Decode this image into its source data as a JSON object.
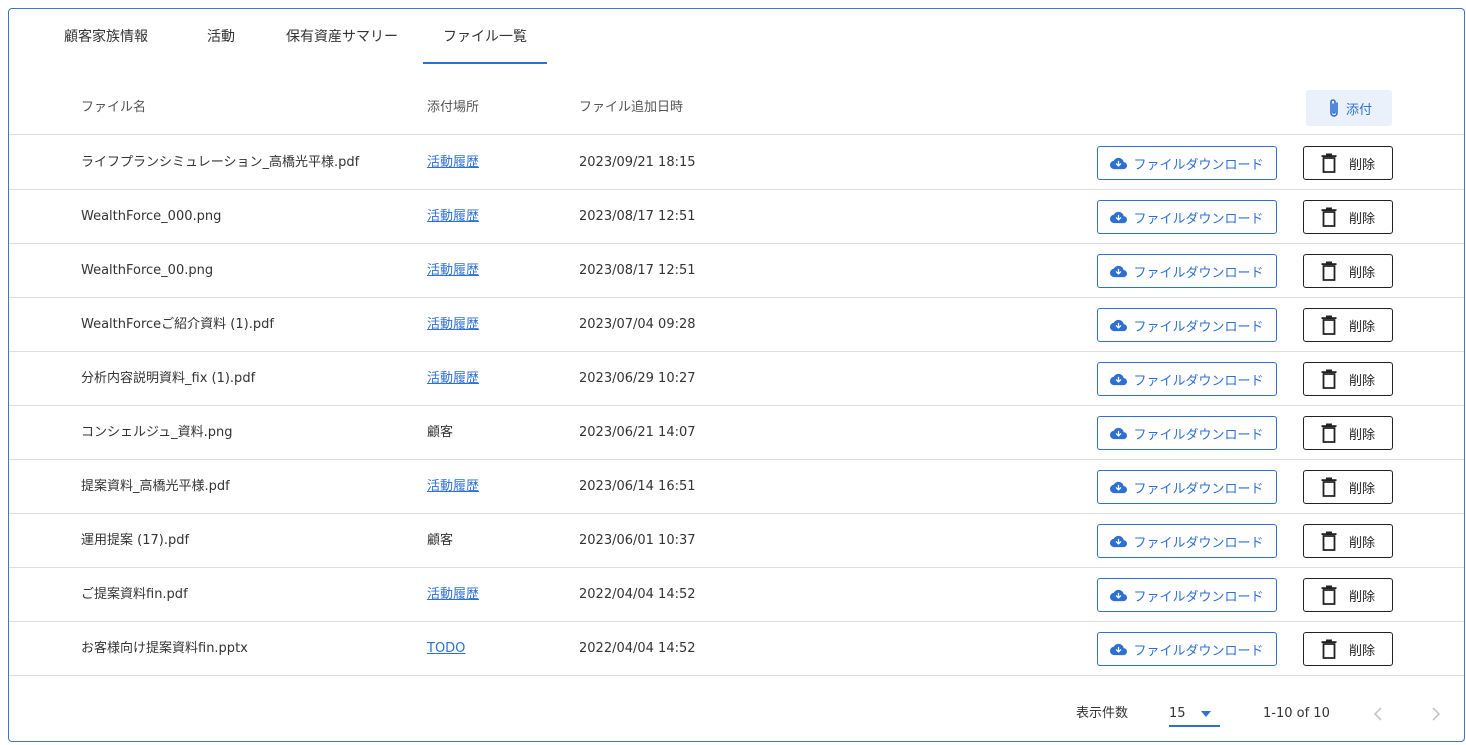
{
  "tabs": [
    {
      "label": "顧客家族情報",
      "active": false
    },
    {
      "label": "活動",
      "active": false
    },
    {
      "label": "保有資産サマリー",
      "active": false
    },
    {
      "label": "ファイル一覧",
      "active": true
    }
  ],
  "table": {
    "headers": {
      "name": "ファイル名",
      "location": "添付場所",
      "date": "ファイル追加日時"
    },
    "attach_label": "添付",
    "download_label": "ファイルダウンロード",
    "delete_label": "削除",
    "rows": [
      {
        "name": "ライフプランシミュレーション_高橋光平様.pdf",
        "location": "活動履歴",
        "is_link": true,
        "date": "2023/09/21 18:15"
      },
      {
        "name": "WealthForce_000.png",
        "location": "活動履歴",
        "is_link": true,
        "date": "2023/08/17 12:51"
      },
      {
        "name": "WealthForce_00.png",
        "location": "活動履歴",
        "is_link": true,
        "date": "2023/08/17 12:51"
      },
      {
        "name": "WealthForceご紹介資料 (1).pdf",
        "location": "活動履歴",
        "is_link": true,
        "date": "2023/07/04 09:28"
      },
      {
        "name": "分析内容説明資料_fix (1).pdf",
        "location": "活動履歴",
        "is_link": true,
        "date": "2023/06/29 10:27"
      },
      {
        "name": "コンシェルジュ_資料.png",
        "location": "顧客",
        "is_link": false,
        "date": "2023/06/21 14:07"
      },
      {
        "name": "提案資料_高橋光平様.pdf",
        "location": "活動履歴",
        "is_link": true,
        "date": "2023/06/14 16:51"
      },
      {
        "name": "運用提案 (17).pdf",
        "location": "顧客",
        "is_link": false,
        "date": "2023/06/01 10:37"
      },
      {
        "name": "ご提案資料fin.pdf",
        "location": "活動履歴",
        "is_link": true,
        "date": "2022/04/04 14:52"
      },
      {
        "name": "お客様向け提案資料fin.pptx",
        "location": "TODO",
        "is_link": true,
        "date": "2022/04/04 14:52"
      }
    ]
  },
  "pagination": {
    "rows_per_page_label": "表示件数",
    "rows_per_page_value": "15",
    "range_text": "1-10 of 10"
  },
  "icons": {
    "attach": "paperclip-icon",
    "download": "cloud-download-icon",
    "delete": "trash-icon",
    "caret": "caret-down-icon",
    "prev": "chevron-left-icon",
    "next": "chevron-right-icon"
  },
  "colors": {
    "accent": "#2d6fd2",
    "border": "#3b78c7",
    "divider": "#dedede",
    "attach_bg": "#eaf1fb"
  }
}
